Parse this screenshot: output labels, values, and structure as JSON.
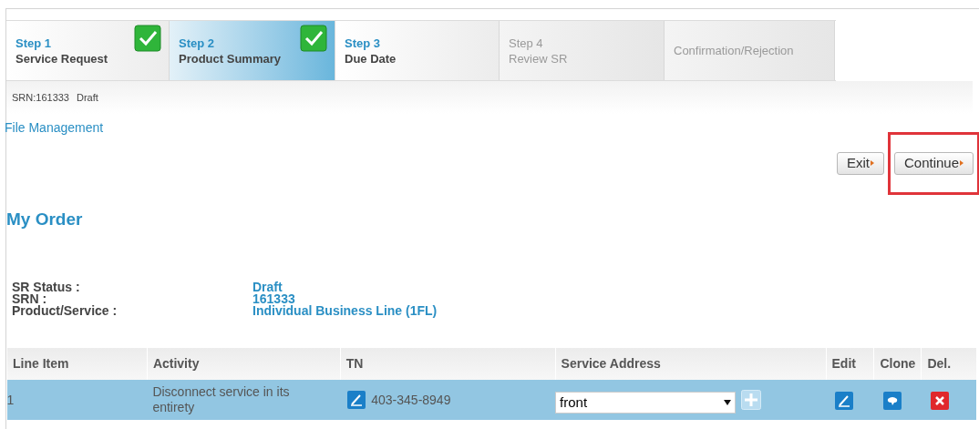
{
  "steps": [
    {
      "step": "Step 1",
      "title": "Service Request",
      "selected": false,
      "completed": true,
      "disabled": false
    },
    {
      "step": "Step 2",
      "title": "Product Summary",
      "selected": true,
      "completed": true,
      "disabled": false
    },
    {
      "step": "Step 3",
      "title": "Due Date",
      "selected": false,
      "completed": false,
      "disabled": false
    },
    {
      "step": "Step 4",
      "title": "Review SR",
      "selected": false,
      "completed": false,
      "disabled": true
    },
    {
      "title": "Confirmation/Rejection",
      "selected": false,
      "completed": false,
      "disabled": true
    }
  ],
  "status_line": {
    "srn": "SRN:161333",
    "status": "Draft"
  },
  "file_link": "File Management",
  "buttons": [
    {
      "label": "Exit",
      "highlighted": false
    },
    {
      "label": "Continue",
      "highlighted": true
    }
  ],
  "heading": "My Order",
  "details": [
    {
      "label": "SR Status :",
      "value": "Draft"
    },
    {
      "label": "SRN :",
      "value": "161333"
    },
    {
      "label": "Product/Service :",
      "value": "Individual Business Line (1FL)"
    }
  ],
  "table": {
    "columns": [
      "Line Item",
      "Activity",
      "TN",
      "Service Address",
      "Edit",
      "Clone",
      "Del."
    ],
    "rows": [
      {
        "line_item": "1",
        "activity": "Disconnect service in its entirety",
        "tn": "403-345-8949",
        "service_address": "front",
        "selected": true
      }
    ]
  }
}
